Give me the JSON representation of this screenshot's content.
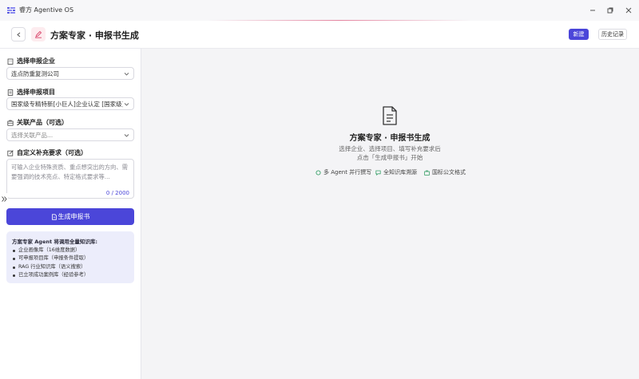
{
  "app": {
    "title": "睿方 Agentive OS"
  },
  "header": {
    "title": "方案专家 · 申报书生成",
    "new_label": "新建",
    "history_label": "历史记录"
  },
  "sidebar": {
    "company": {
      "label": "选择申报企业",
      "value": "连点防重复测公司"
    },
    "project": {
      "label": "选择申报项目",
      "value": "国家级专精特新[小巨人]企业认定 [国家级]"
    },
    "product": {
      "label": "关联产品（可选）",
      "placeholder": "选择关联产品..."
    },
    "custom": {
      "label": "自定义补充要求（可选）",
      "placeholder": "可输入企业特殊资质、重点想突出的方向、需要强调的技术亮点、特定格式要求等...",
      "counter": "0 / 2000"
    },
    "generate_label": "生成申报书",
    "info": {
      "title": "方案专家 Agent 将调用全量知识库:",
      "items": [
        "企业画像库（16维度数据）",
        "可申报项目库（申报条件提取）",
        "RAG 行业知识库（语义搜索）",
        "已立项成功案例库（经验参考）"
      ]
    }
  },
  "main": {
    "empty_title": "方案专家 · 申报书生成",
    "empty_desc_1": "选择企业、选择项目、填写补充要求后",
    "empty_desc_2": "点击「生成申报书」开始",
    "features": [
      "多 Agent 并行撰写",
      "全知识库溯源",
      "国标公文格式"
    ]
  },
  "colors": {
    "accent": "#4b46d9",
    "info_bg": "#ecedfb",
    "feature_green": "#3aa16b"
  },
  "icons": {
    "app": "app-logo-icon",
    "back": "chevron-left-icon",
    "page": "pen-icon",
    "company": "building-icon",
    "project": "document-icon",
    "product": "box-icon",
    "custom": "edit-icon",
    "empty": "document-icon",
    "features": [
      "circle-icon",
      "chat-icon",
      "briefcase-icon"
    ]
  }
}
